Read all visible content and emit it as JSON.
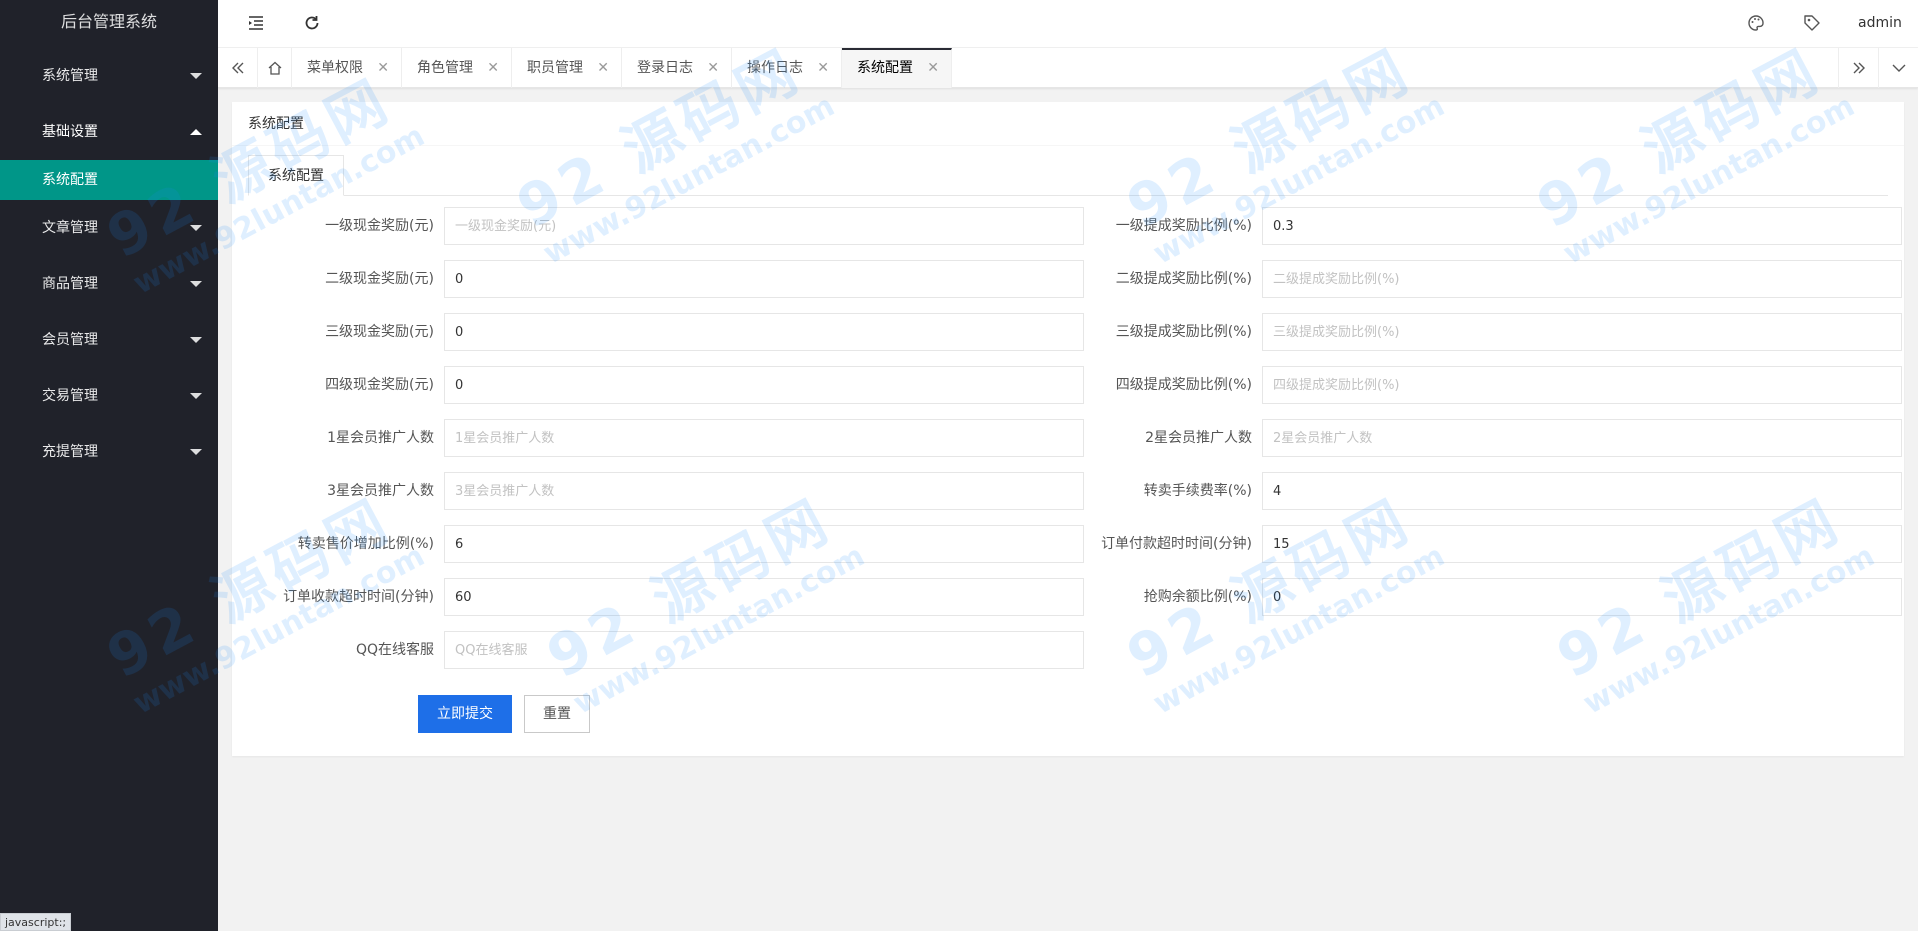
{
  "app": {
    "title": "后台管理系统"
  },
  "sidebar": {
    "items": [
      {
        "label": "系统管理",
        "open": false
      },
      {
        "label": "基础设置",
        "open": true
      },
      {
        "label": "文章管理",
        "open": false
      },
      {
        "label": "商品管理",
        "open": false
      },
      {
        "label": "会员管理",
        "open": false
      },
      {
        "label": "交易管理",
        "open": false
      },
      {
        "label": "充提管理",
        "open": false
      }
    ],
    "active_child": "系统配置"
  },
  "header": {
    "menu_toggle_icon": "indent-icon",
    "refresh_icon": "refresh-icon",
    "theme_icon": "palette-icon",
    "tag_icon": "tag-icon",
    "user": "admin"
  },
  "tabs": {
    "items": [
      "菜单权限",
      "角色管理",
      "职员管理",
      "登录日志",
      "操作日志",
      "系统配置"
    ],
    "active": "系统配置"
  },
  "card": {
    "title": "系统配置",
    "sub_tab": "系统配置"
  },
  "form": {
    "rows": [
      {
        "left": {
          "label": "一级现金奖励(元)",
          "value": "",
          "placeholder": "一级现金奖励(元)"
        },
        "right": {
          "label": "一级提成奖励比例(%)",
          "value": "0.3",
          "placeholder": "一级提成奖励比例(%)"
        }
      },
      {
        "left": {
          "label": "二级现金奖励(元)",
          "value": "0",
          "placeholder": "二级现金奖励(元)"
        },
        "right": {
          "label": "二级提成奖励比例(%)",
          "value": "",
          "placeholder": "二级提成奖励比例(%)"
        }
      },
      {
        "left": {
          "label": "三级现金奖励(元)",
          "value": "0",
          "placeholder": "三级现金奖励(元)"
        },
        "right": {
          "label": "三级提成奖励比例(%)",
          "value": "",
          "placeholder": "三级提成奖励比例(%)"
        }
      },
      {
        "left": {
          "label": "四级现金奖励(元)",
          "value": "0",
          "placeholder": "四级现金奖励(元)"
        },
        "right": {
          "label": "四级提成奖励比例(%)",
          "value": "",
          "placeholder": "四级提成奖励比例(%)"
        }
      },
      {
        "left": {
          "label": "1星会员推广人数",
          "value": "",
          "placeholder": "1星会员推广人数"
        },
        "right": {
          "label": "2星会员推广人数",
          "value": "",
          "placeholder": "2星会员推广人数"
        }
      },
      {
        "left": {
          "label": "3星会员推广人数",
          "value": "",
          "placeholder": "3星会员推广人数"
        },
        "right": {
          "label": "转卖手续费率(%)",
          "value": "4",
          "placeholder": "转卖手续费率(%)"
        }
      },
      {
        "left": {
          "label": "转卖售价增加比例(%)",
          "value": "6",
          "placeholder": "转卖售价增加比例(%)"
        },
        "right": {
          "label": "订单付款超时时间(分钟)",
          "value": "15",
          "placeholder": "订单付款超时时间(分钟)"
        }
      },
      {
        "left": {
          "label": "订单收款超时时间(分钟)",
          "value": "60",
          "placeholder": "订单收款超时时间(分钟)"
        },
        "right": {
          "label": "抢购余额比例(%)",
          "value": "0",
          "placeholder": "抢购余额比例(%)"
        }
      },
      {
        "left": {
          "label": "QQ在线客服",
          "value": "",
          "placeholder": "QQ在线客服"
        }
      }
    ],
    "submit_label": "立即提交",
    "reset_label": "重置"
  },
  "status_tip": "javascript:;",
  "watermark": {
    "main": "92 源码网",
    "sub": "www.92luntan.com"
  },
  "colors": {
    "sidebar_bg": "#20222a",
    "active_green": "#009688",
    "primary_blue": "#1e6fe8"
  }
}
